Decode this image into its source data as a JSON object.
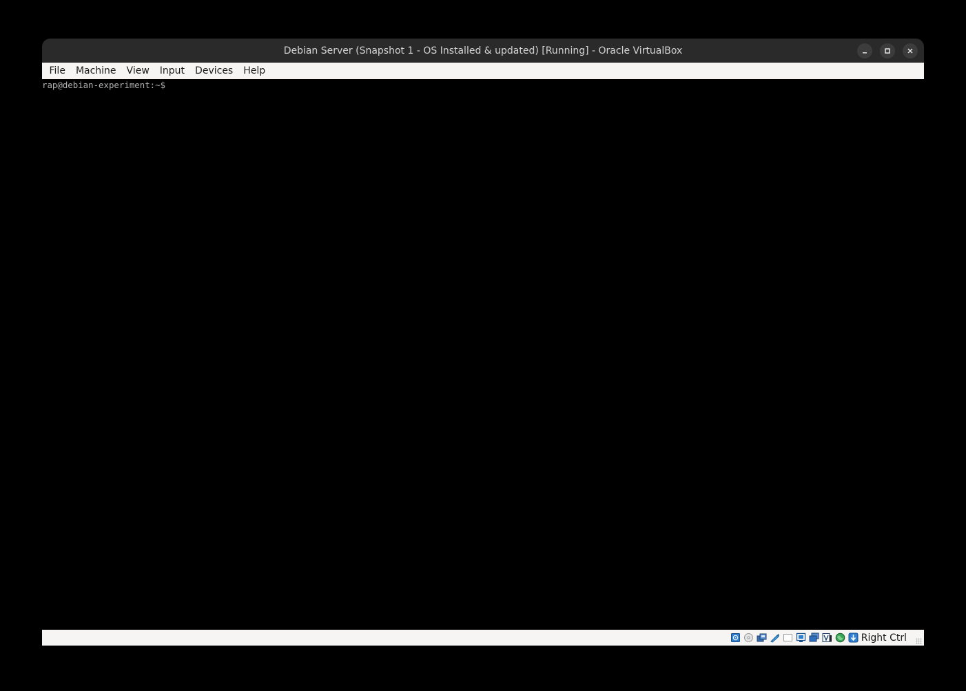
{
  "window": {
    "title": "Debian Server (Snapshot 1 - OS Installed & updated) [Running] - Oracle VirtualBox"
  },
  "menu": {
    "items": [
      "File",
      "Machine",
      "View",
      "Input",
      "Devices",
      "Help"
    ]
  },
  "terminal": {
    "prompt": "rap@debian-experiment:~$"
  },
  "statusbar": {
    "icons": [
      "hard-disk-icon",
      "optical-drive-icon",
      "audio-icon",
      "network-icon",
      "usb-icon",
      "shared-folders-icon",
      "display-icon",
      "video-capture-icon",
      "cpu-virtualization-icon",
      "mouse-integration-icon",
      "keyboard-capture-icon"
    ],
    "host_key": "Right Ctrl"
  },
  "colors": {
    "titlebar": "#2a2a2a",
    "menubar": "#f6f5f4",
    "screen": "#000000",
    "terminal_text": "#b2b2b2"
  }
}
